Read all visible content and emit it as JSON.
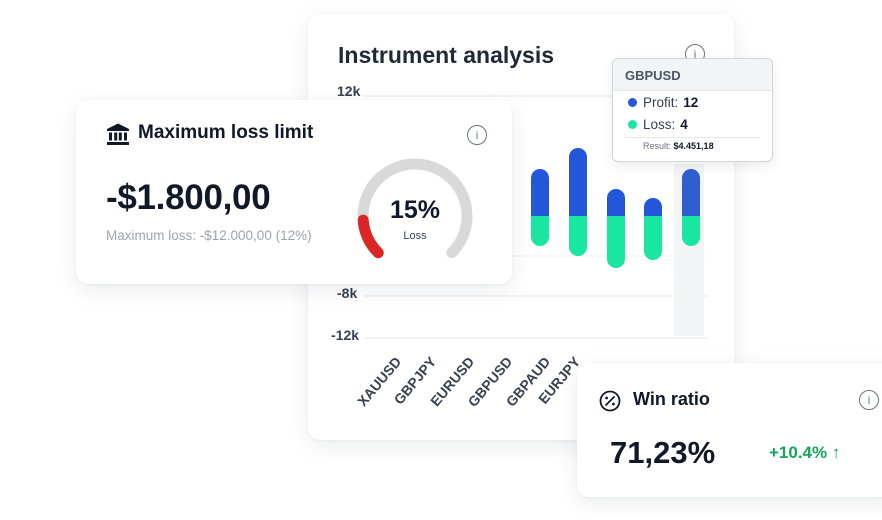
{
  "instrument_analysis": {
    "title": "Instrument analysis",
    "info_icon": "i",
    "y_ticks": [
      "12k",
      "-8k",
      "-12k"
    ],
    "categories": [
      "XAUUSD",
      "GBPJPY",
      "EURUSD",
      "GBPUSD",
      "GBPAUD",
      "EURJPY"
    ],
    "tooltip": {
      "instrument": "GBPUSD",
      "profit_label": "Profit:",
      "profit_value": "12",
      "loss_label": "Loss:",
      "loss_value": "4",
      "result_label": "Result:",
      "result_value": "$4.451,18"
    },
    "colors": {
      "profit": "#2456d9",
      "loss": "#19e6a1"
    }
  },
  "max_loss": {
    "title": "Maximum loss limit",
    "amount": "-$1.800,00",
    "subtitle": "Maximum loss: -$12.000,00 (12%)",
    "gauge_value": "15%",
    "gauge_label": "Loss",
    "gauge_fraction": 0.15,
    "colors": {
      "gauge_fill": "#dc2626",
      "gauge_track": "#d9d9d9"
    }
  },
  "win_ratio": {
    "title": "Win ratio",
    "value": "71,23%",
    "delta": "+10.4% ↑",
    "colors": {
      "delta": "#16a35a"
    }
  }
}
